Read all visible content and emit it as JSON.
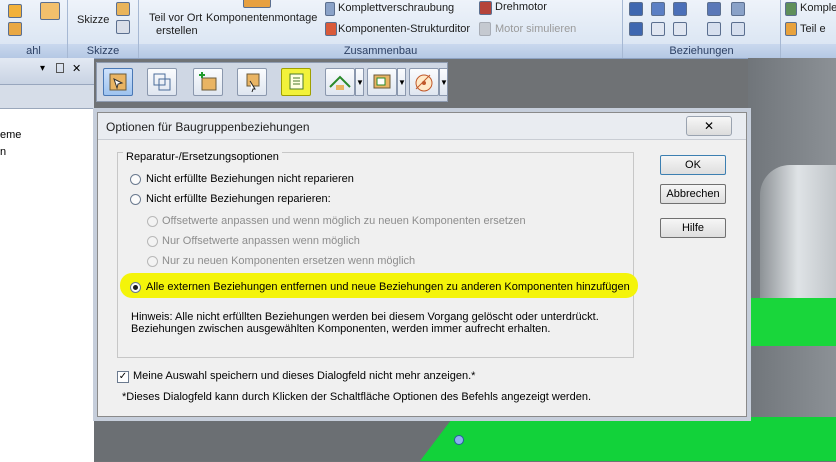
{
  "ribbon": {
    "groups": [
      {
        "name": "auswahl",
        "caption": "ahl"
      },
      {
        "name": "skizze",
        "caption": "Skizze",
        "items": [
          "Skizze"
        ]
      },
      {
        "name": "zusammenbau",
        "caption": "Zusammenbau",
        "items": [
          "Teil vor Ort",
          "erstellen",
          "Komponentenmontage",
          "Komplettverschraubung",
          "Drehmotor",
          "Komponenten-Strukturditor",
          "Motor simulieren"
        ]
      },
      {
        "name": "beziehungen",
        "caption": "Beziehungen"
      },
      {
        "name": "rest",
        "caption": "",
        "items": [
          "Komplett",
          "Teil e"
        ]
      }
    ]
  },
  "left_panel": {
    "controls": [
      "▾",
      "✕"
    ],
    "tree_items": [
      "eme",
      "n"
    ]
  },
  "mini_toolbar": {
    "buttons": [
      "select-tool-icon",
      "copy-frame-icon",
      "add-component-icon",
      "insert-part-icon",
      "options-icon",
      "mate-icon",
      "align-icon",
      "angle-icon"
    ]
  },
  "dialog": {
    "title": "Optionen für Baugruppenbeziehungen",
    "close_label": "✕",
    "group_label": "Reparatur-/Ersetzungsoptionen",
    "options": {
      "no_repair": "Nicht erfüllte Beziehungen nicht reparieren",
      "repair": "Nicht erfüllte Beziehungen reparieren:",
      "sub1": "Offsetwerte anpassen und wenn möglich zu neuen Komponenten ersetzen",
      "sub2": "Nur Offsetwerte anpassen wenn möglich",
      "sub3": "Nur zu neuen Komponenten ersetzen wenn möglich",
      "remove_all": "Alle externen Beziehungen entfernen und neue Beziehungen zu anderen Komponenten hinzufügen"
    },
    "selected_option": "remove_all",
    "hint_line1": "Hinweis: Alle nicht erfüllten Beziehungen werden bei diesem Vorgang gelöscht oder unterdrückt.",
    "hint_line2": "Beziehungen zwischen ausgewählten Komponenten, werden immer aufrecht erhalten.",
    "buttons": {
      "ok": "OK",
      "cancel": "Abbrechen",
      "help": "Hilfe"
    },
    "remember_checkbox": {
      "label": "Meine Auswahl speichern und dieses Dialogfeld nicht mehr anzeigen.*",
      "checked": "✓"
    },
    "footnote": "*Dieses Dialogfeld kann durch Klicken der Schaltfläche Optionen des Befehls angezeigt werden."
  },
  "colors": {
    "highlight": "#f4f40a",
    "green_part": "#19d63b",
    "ribbon_caption": "#2b3f63"
  }
}
